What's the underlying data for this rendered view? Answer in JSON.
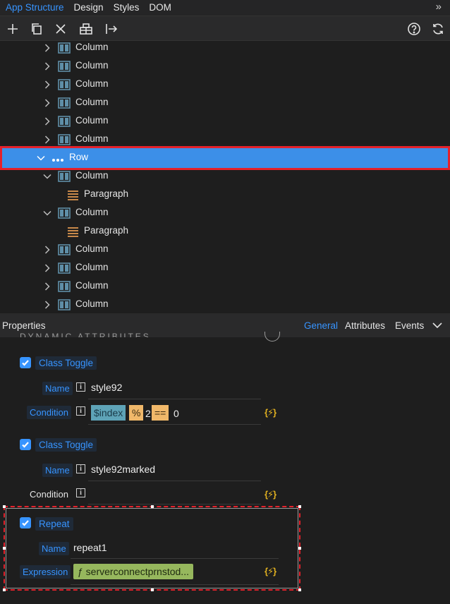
{
  "topbar": {
    "tabs": [
      "App Structure",
      "Design",
      "Styles",
      "DOM"
    ],
    "active_tab": "App Structure",
    "more_icon": "double-chevron-right"
  },
  "toolbar": {
    "left_icons": [
      "add-icon",
      "duplicate-icon",
      "delete-icon",
      "component-icon",
      "move-into-icon"
    ],
    "right_icons": [
      "help-icon",
      "refresh-icon"
    ]
  },
  "tree": {
    "nodes": [
      {
        "label": "Column",
        "type": "column",
        "expanded": false,
        "level": 1
      },
      {
        "label": "Column",
        "type": "column",
        "expanded": false,
        "level": 1
      },
      {
        "label": "Column",
        "type": "column",
        "expanded": false,
        "level": 1
      },
      {
        "label": "Column",
        "type": "column",
        "expanded": false,
        "level": 1
      },
      {
        "label": "Column",
        "type": "column",
        "expanded": false,
        "level": 1
      },
      {
        "label": "Column",
        "type": "column",
        "expanded": false,
        "level": 1
      },
      {
        "label": "Row",
        "type": "row",
        "expanded": true,
        "level": 0,
        "selected": true
      },
      {
        "label": "Column",
        "type": "column",
        "expanded": true,
        "level": 1
      },
      {
        "label": "Paragraph",
        "type": "paragraph",
        "level": 2
      },
      {
        "label": "Column",
        "type": "column",
        "expanded": true,
        "level": 1
      },
      {
        "label": "Paragraph",
        "type": "paragraph",
        "level": 2
      },
      {
        "label": "Column",
        "type": "column",
        "expanded": false,
        "level": 1
      },
      {
        "label": "Column",
        "type": "column",
        "expanded": false,
        "level": 1
      },
      {
        "label": "Column",
        "type": "column",
        "expanded": false,
        "level": 1
      },
      {
        "label": "Column",
        "type": "column",
        "expanded": false,
        "level": 1
      }
    ]
  },
  "properties": {
    "title": "Properties",
    "tabs": [
      "General",
      "Attributes",
      "Events"
    ],
    "active_tab": "General",
    "section_title": "DYNAMIC ATTRIBUTES",
    "class_toggle_1": {
      "label": "Class Toggle",
      "checked": true,
      "name_label": "Name",
      "name_value": "style92",
      "condition_label": "Condition",
      "condition_tokens": [
        {
          "text": "$index",
          "kind": "var"
        },
        {
          "text": "%",
          "kind": "op"
        },
        {
          "text": "2",
          "kind": "num"
        },
        {
          "text": "==",
          "kind": "op"
        },
        {
          "text": "0",
          "kind": "num"
        }
      ]
    },
    "class_toggle_2": {
      "label": "Class Toggle",
      "checked": true,
      "name_label": "Name",
      "name_value": "style92marked",
      "condition_label": "Condition"
    },
    "repeat": {
      "label": "Repeat",
      "checked": true,
      "name_label": "Name",
      "name_value": "repeat1",
      "expression_label": "Expression",
      "expression_value": "ƒ serverconnectprnstod..."
    },
    "dynamic_icon_text": "{⚡}"
  },
  "colors": {
    "accent": "#3794ff",
    "selected_row": "#3c8fe8",
    "highlight_border": "#e5212b",
    "column_icon": "#5f8fa8",
    "paragraph_icon": "#c8894a"
  }
}
